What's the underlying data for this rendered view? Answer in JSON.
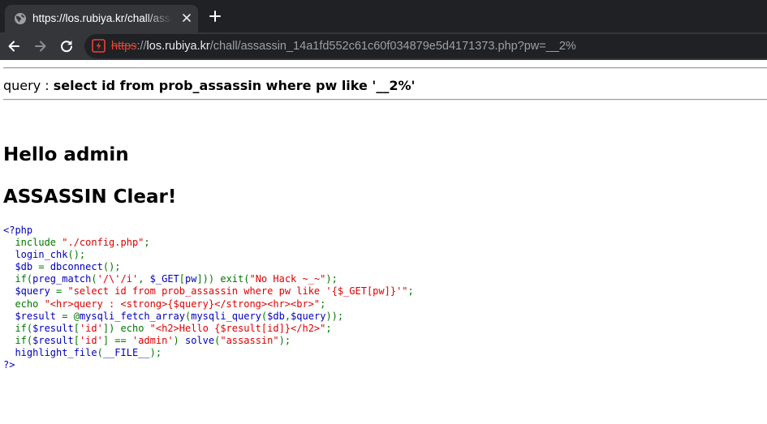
{
  "browser": {
    "tab_title": "https://los.rubiya.kr/chall/assassin_14a1fd552c61c60f034879e5d4171373.php?pw=__2%",
    "url_scheme": "https",
    "url_sep": "://",
    "url_host": "los.rubiya.kr",
    "url_path": "/chall/assassin_14a1fd552c61c60f034879e5d4171373.php?pw=__2%",
    "icons": {
      "favicon": "globe-icon",
      "close": "close-icon",
      "new_tab": "plus-icon",
      "back": "arrow-left-icon",
      "forward": "arrow-right-icon",
      "reload": "reload-icon",
      "security": "not-secure-icon"
    }
  },
  "page": {
    "query_label": "query : ",
    "query_sql": "select id from prob_assassin where pw like '__2%'",
    "hello": "Hello admin",
    "clear": "ASSASSIN Clear!"
  },
  "code_colors": {
    "default": "#0000BB",
    "text": "#000000",
    "keyword": "#007700",
    "string": "#DD0000"
  },
  "code_lines": [
    [
      [
        "default",
        "<?php"
      ]
    ],
    [
      [
        "key",
        "  include "
      ],
      [
        "str",
        "\"./config.php\""
      ],
      [
        "key",
        ";"
      ]
    ],
    [
      [
        "default",
        "  login_chk"
      ],
      [
        "key",
        "();"
      ]
    ],
    [
      [
        "default",
        "  $db "
      ],
      [
        "key",
        "= "
      ],
      [
        "default",
        "dbconnect"
      ],
      [
        "key",
        "();"
      ]
    ],
    [
      [
        "key",
        "  if("
      ],
      [
        "default",
        "preg_match"
      ],
      [
        "key",
        "("
      ],
      [
        "str",
        "'/\\'/i'"
      ],
      [
        "key",
        ", "
      ],
      [
        "default",
        "$_GET"
      ],
      [
        "key",
        "["
      ],
      [
        "default",
        "pw"
      ],
      [
        "key",
        "])) exit("
      ],
      [
        "str",
        "\"No Hack ~_~\""
      ],
      [
        "key",
        ");"
      ]
    ],
    [
      [
        "default",
        "  $query "
      ],
      [
        "key",
        "= "
      ],
      [
        "str",
        "\"select id from prob_assassin where pw like '{$_GET[pw]}'\""
      ],
      [
        "key",
        ";"
      ]
    ],
    [
      [
        "key",
        "  echo "
      ],
      [
        "str",
        "\"<hr>query : <strong>{$query}</strong><hr><br>\""
      ],
      [
        "key",
        ";"
      ]
    ],
    [
      [
        "default",
        "  $result "
      ],
      [
        "key",
        "= @"
      ],
      [
        "default",
        "mysqli_fetch_array"
      ],
      [
        "key",
        "("
      ],
      [
        "default",
        "mysqli_query"
      ],
      [
        "key",
        "("
      ],
      [
        "default",
        "$db"
      ],
      [
        "key",
        ","
      ],
      [
        "default",
        "$query"
      ],
      [
        "key",
        "));"
      ]
    ],
    [
      [
        "key",
        "  if("
      ],
      [
        "default",
        "$result"
      ],
      [
        "key",
        "["
      ],
      [
        "str",
        "'id'"
      ],
      [
        "key",
        "]) echo "
      ],
      [
        "str",
        "\"<h2>Hello {$result[id]}</h2>\""
      ],
      [
        "key",
        ";"
      ]
    ],
    [
      [
        "key",
        "  if("
      ],
      [
        "default",
        "$result"
      ],
      [
        "key",
        "["
      ],
      [
        "str",
        "'id'"
      ],
      [
        "key",
        "] == "
      ],
      [
        "str",
        "'admin'"
      ],
      [
        "key",
        ") "
      ],
      [
        "default",
        "solve"
      ],
      [
        "key",
        "("
      ],
      [
        "str",
        "\"assassin\""
      ],
      [
        "key",
        ");"
      ]
    ],
    [
      [
        "default",
        "  highlight_file"
      ],
      [
        "key",
        "("
      ],
      [
        "default",
        "__FILE__"
      ],
      [
        "key",
        ");"
      ]
    ],
    [
      [
        "default",
        "?>"
      ]
    ]
  ]
}
